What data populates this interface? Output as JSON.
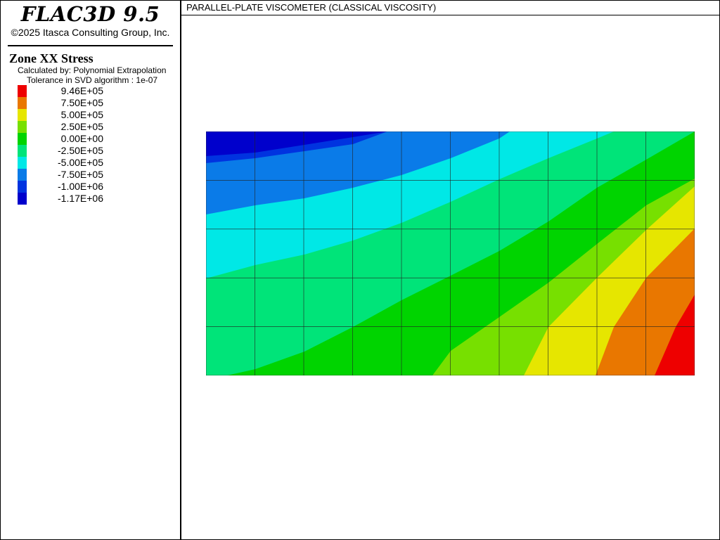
{
  "app": {
    "title": "FLAC3D 9.5",
    "copyright": "©2025 Itasca Consulting Group, Inc."
  },
  "plot": {
    "caption": "PARALLEL-PLATE VISCOMETER (CLASSICAL VISCOSITY)",
    "title": "Zone XX Stress",
    "calculated_by": "Calculated by: Polynomial Extrapolation",
    "tolerance": "Tolerance in SVD algorithm : 1e-07"
  },
  "legend": {
    "entries": [
      {
        "label": "9.46E+05",
        "color": "#ee0000"
      },
      {
        "label": "7.50E+05",
        "color": "#e97700"
      },
      {
        "label": "5.00E+05",
        "color": "#e6e600"
      },
      {
        "label": "2.50E+05",
        "color": "#77e000"
      },
      {
        "label": "0.00E+00",
        "color": "#00d400"
      },
      {
        "label": "-2.50E+05",
        "color": "#00e479"
      },
      {
        "label": "-5.00E+05",
        "color": "#00e8e6"
      },
      {
        "label": "-7.50E+05",
        "color": "#0a7be8"
      },
      {
        "label": "-1.00E+06",
        "color": "#0033e0"
      },
      {
        "label": "-1.17E+06",
        "color": "#0000cc"
      }
    ]
  },
  "mesh": {
    "columns": 10,
    "rows": 5,
    "line_color": "#222222"
  }
}
